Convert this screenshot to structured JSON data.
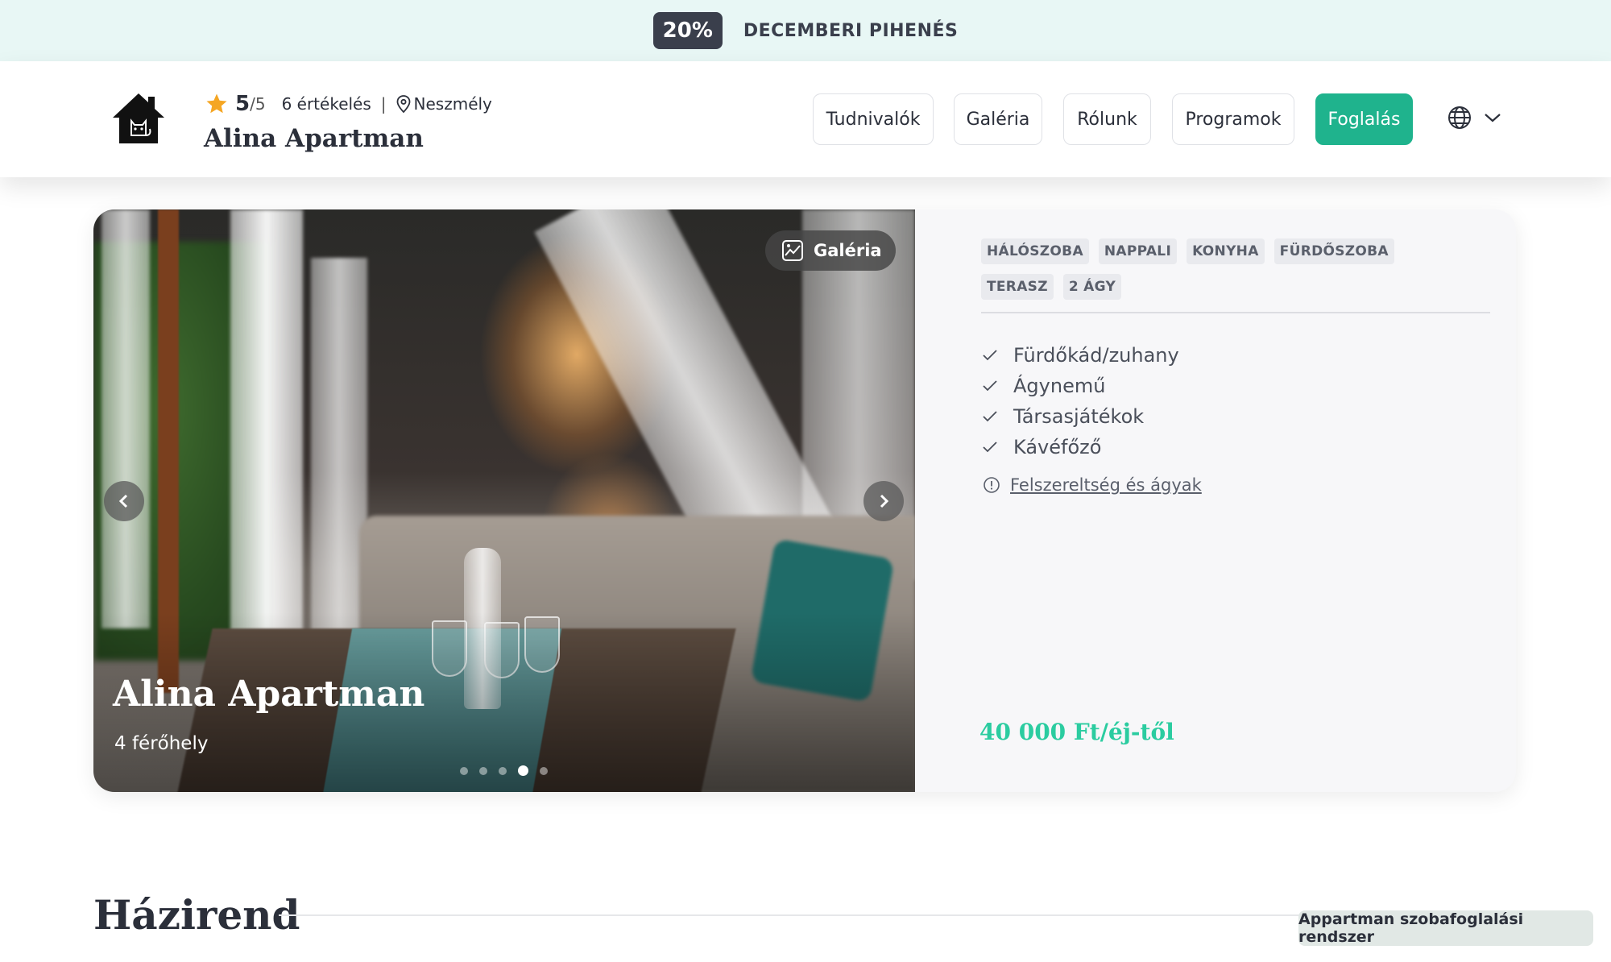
{
  "promo": {
    "discount": "20%",
    "text": "DECEMBERI PIHENÉS"
  },
  "header": {
    "rating_score": "5",
    "rating_max": "/5",
    "reviews": "6 értékelés",
    "separator": "|",
    "location": "Neszmély",
    "title": "Alina Apartman",
    "nav": [
      "Tudnivalók",
      "Galéria",
      "Rólunk",
      "Programok"
    ],
    "book_label": "Foglalás",
    "icons": {
      "logo": "house-cat-logo",
      "star": "star-icon",
      "location": "pin-icon",
      "language": "globe-icon",
      "dropdown": "chevron-down-icon"
    }
  },
  "card": {
    "gallery_label": "Galéria",
    "photo_title": "Alina Apartman",
    "photo_subtitle": "4 férőhely",
    "slides_total": 5,
    "slide_active": 4,
    "tags": [
      "HÁLÓSZOBA",
      "NAPPALI",
      "KONYHA",
      "FÜRDŐSZOBA",
      "TERASZ",
      "2 ÁGY"
    ],
    "amenities": [
      "Fürdőkád/zuhany",
      "Ágynemű",
      "Társasjátékok",
      "Kávéfőző"
    ],
    "details_link": "Felszereltség és ágyak",
    "price": "40 000 Ft/éj-től"
  },
  "rules": {
    "title": "Házirend"
  },
  "footer": {
    "badge": "Appartman szobafoglalási rendszer"
  },
  "colors": {
    "accent": "#1fb38d",
    "price": "#2bcca0",
    "promo_bg": "#e8f7f5",
    "star": "#f5a623"
  }
}
